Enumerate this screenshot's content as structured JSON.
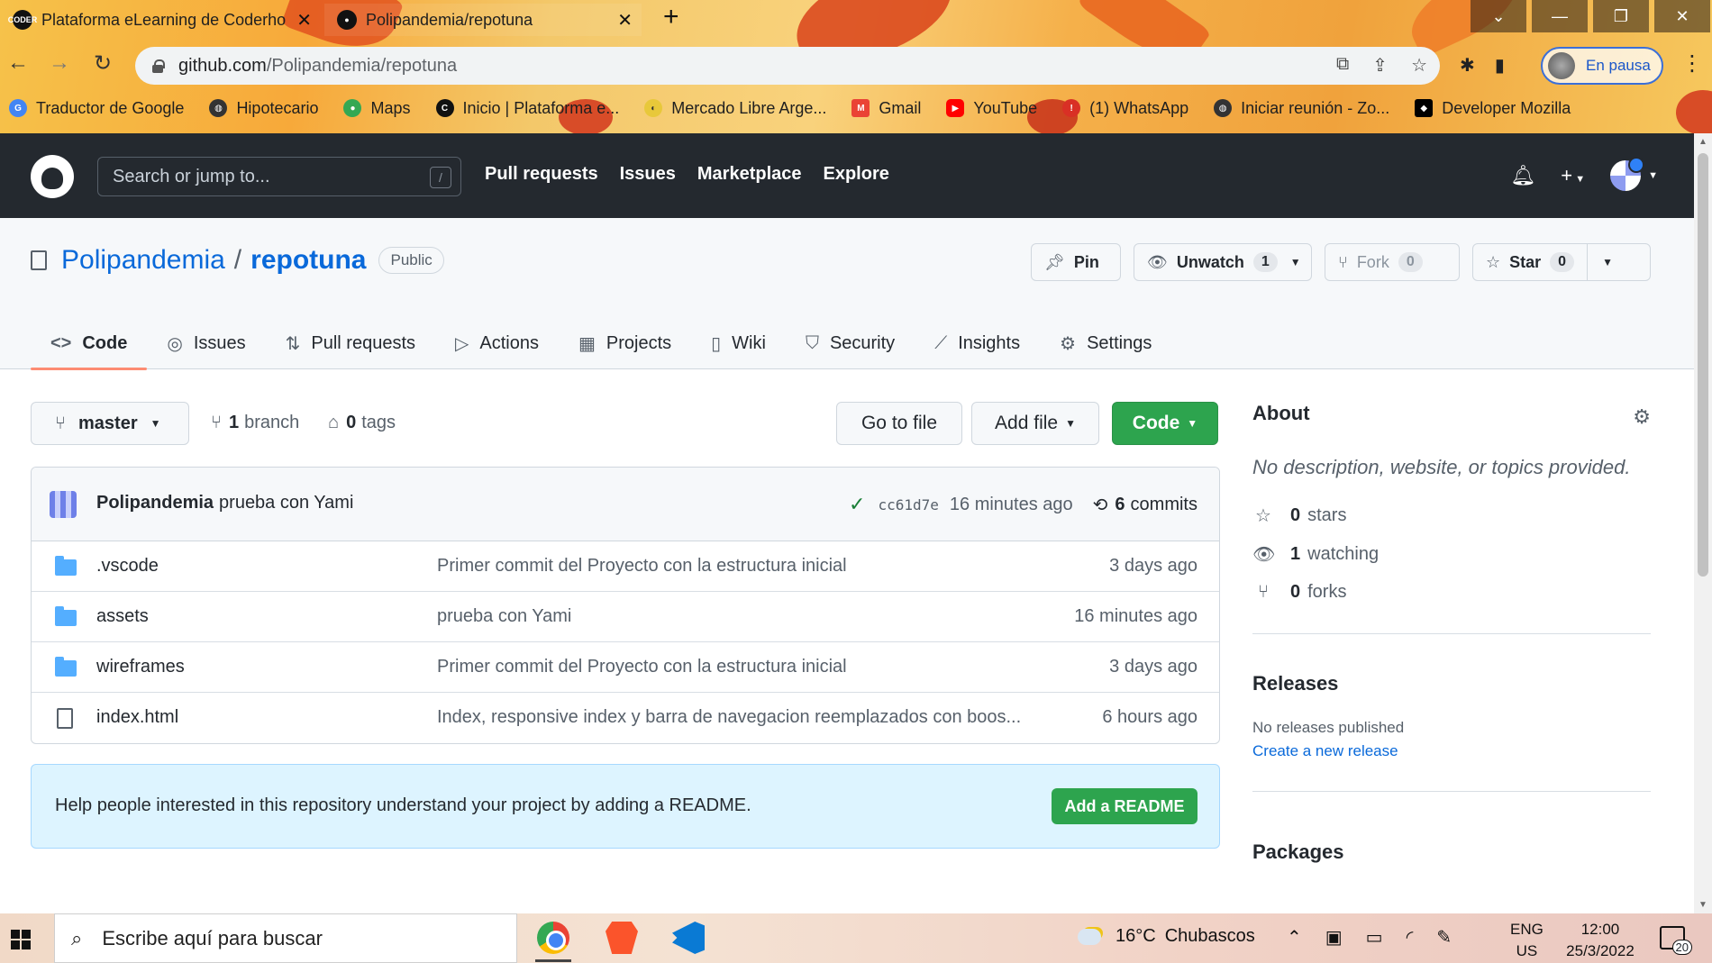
{
  "browser": {
    "tabs": [
      {
        "title": "Plataforma eLearning de Coderhouse",
        "active": false
      },
      {
        "title": "Polipandemia/repotuna",
        "active": true
      }
    ],
    "url_host": "github.com",
    "url_path": "/Polipandemia/repotuna",
    "profile_label": "En pausa",
    "bookmarks": [
      {
        "label": "Traductor de Google",
        "icon": "google-translate-icon",
        "color": "#4285f4"
      },
      {
        "label": "Hipotecario",
        "icon": "globe-icon",
        "color": "#333333"
      },
      {
        "label": "Maps",
        "icon": "maps-pin-icon",
        "color": "#34a853"
      },
      {
        "label": "Inicio | Plataforma e...",
        "icon": "coder-icon",
        "color": "#111111"
      },
      {
        "label": "Mercado Libre Arge...",
        "icon": "handshake-icon",
        "color": "#e8c83a"
      },
      {
        "label": "Gmail",
        "icon": "gmail-icon",
        "color": "#ea4335"
      },
      {
        "label": "YouTube",
        "icon": "youtube-icon",
        "color": "#ff0000"
      },
      {
        "label": "(1) WhatsApp",
        "icon": "alert-icon",
        "color": "#d93025"
      },
      {
        "label": "Iniciar reunión - Zo...",
        "icon": "globe-icon",
        "color": "#333333"
      },
      {
        "label": "Developer Mozilla",
        "icon": "mdn-icon",
        "color": "#000000"
      }
    ]
  },
  "github": {
    "search_placeholder": "Search or jump to...",
    "search_key": "/",
    "nav": [
      "Pull requests",
      "Issues",
      "Marketplace",
      "Explore"
    ]
  },
  "repo": {
    "owner": "Polipandemia",
    "separator": "/",
    "name": "repotuna",
    "visibility": "Public",
    "actions": {
      "pin": "Pin",
      "unwatch": "Unwatch",
      "unwatch_count": "1",
      "fork": "Fork",
      "fork_count": "0",
      "star": "Star",
      "star_count": "0"
    },
    "tabs": [
      {
        "label": "Code",
        "icon": "<>"
      },
      {
        "label": "Issues",
        "icon": "◎"
      },
      {
        "label": "Pull requests",
        "icon": "⇅"
      },
      {
        "label": "Actions",
        "icon": "▷"
      },
      {
        "label": "Projects",
        "icon": "▦"
      },
      {
        "label": "Wiki",
        "icon": "▯"
      },
      {
        "label": "Security",
        "icon": "⛉"
      },
      {
        "label": "Insights",
        "icon": "⟋"
      },
      {
        "label": "Settings",
        "icon": "⚙"
      }
    ],
    "active_tab": "Code"
  },
  "code": {
    "branch": "master",
    "branch_count": "1",
    "branch_label": "branch",
    "tag_count": "0",
    "tag_label": "tags",
    "go_to_file": "Go to file",
    "add_file": "Add file",
    "code_button": "Code",
    "latest_commit": {
      "author": "Polipandemia",
      "message": "prueba con Yami",
      "sha": "cc61d7e",
      "age": "16 minutes ago",
      "commit_count": "6",
      "commit_label": "commits"
    },
    "files": [
      {
        "type": "folder",
        "name": ".vscode",
        "commit": "Primer commit del Proyecto con la estructura inicial",
        "age": "3 days ago"
      },
      {
        "type": "folder",
        "name": "assets",
        "commit": "prueba con Yami",
        "age": "16 minutes ago"
      },
      {
        "type": "folder",
        "name": "wireframes",
        "commit": "Primer commit del Proyecto con la estructura inicial",
        "age": "3 days ago"
      },
      {
        "type": "file",
        "name": "index.html",
        "commit": "Index, responsive index y barra de navegacion reemplazados con boos...",
        "age": "6 hours ago"
      }
    ],
    "readme_prompt": "Help people interested in this repository understand your project by adding a README.",
    "readme_button": "Add a README"
  },
  "about": {
    "title": "About",
    "description": "No description, website, or topics provided.",
    "stars_count": "0",
    "stars_label": "stars",
    "watching_count": "1",
    "watching_label": "watching",
    "forks_count": "0",
    "forks_label": "forks",
    "releases_title": "Releases",
    "releases_none": "No releases published",
    "releases_link": "Create a new release",
    "packages_title": "Packages"
  },
  "taskbar": {
    "search_placeholder": "Escribe aquí para buscar",
    "weather_temp": "16°C",
    "weather_text": "Chubascos",
    "lang_top": "ENG",
    "lang_bottom": "US",
    "time": "12:00",
    "date": "25/3/2022",
    "notifications": "20"
  },
  "colors": {
    "github_header": "#24292f",
    "link_blue": "#0969da",
    "green_button": "#2da44e",
    "active_tab_underline": "#fd8c73",
    "readme_bg": "#ddf4ff"
  }
}
